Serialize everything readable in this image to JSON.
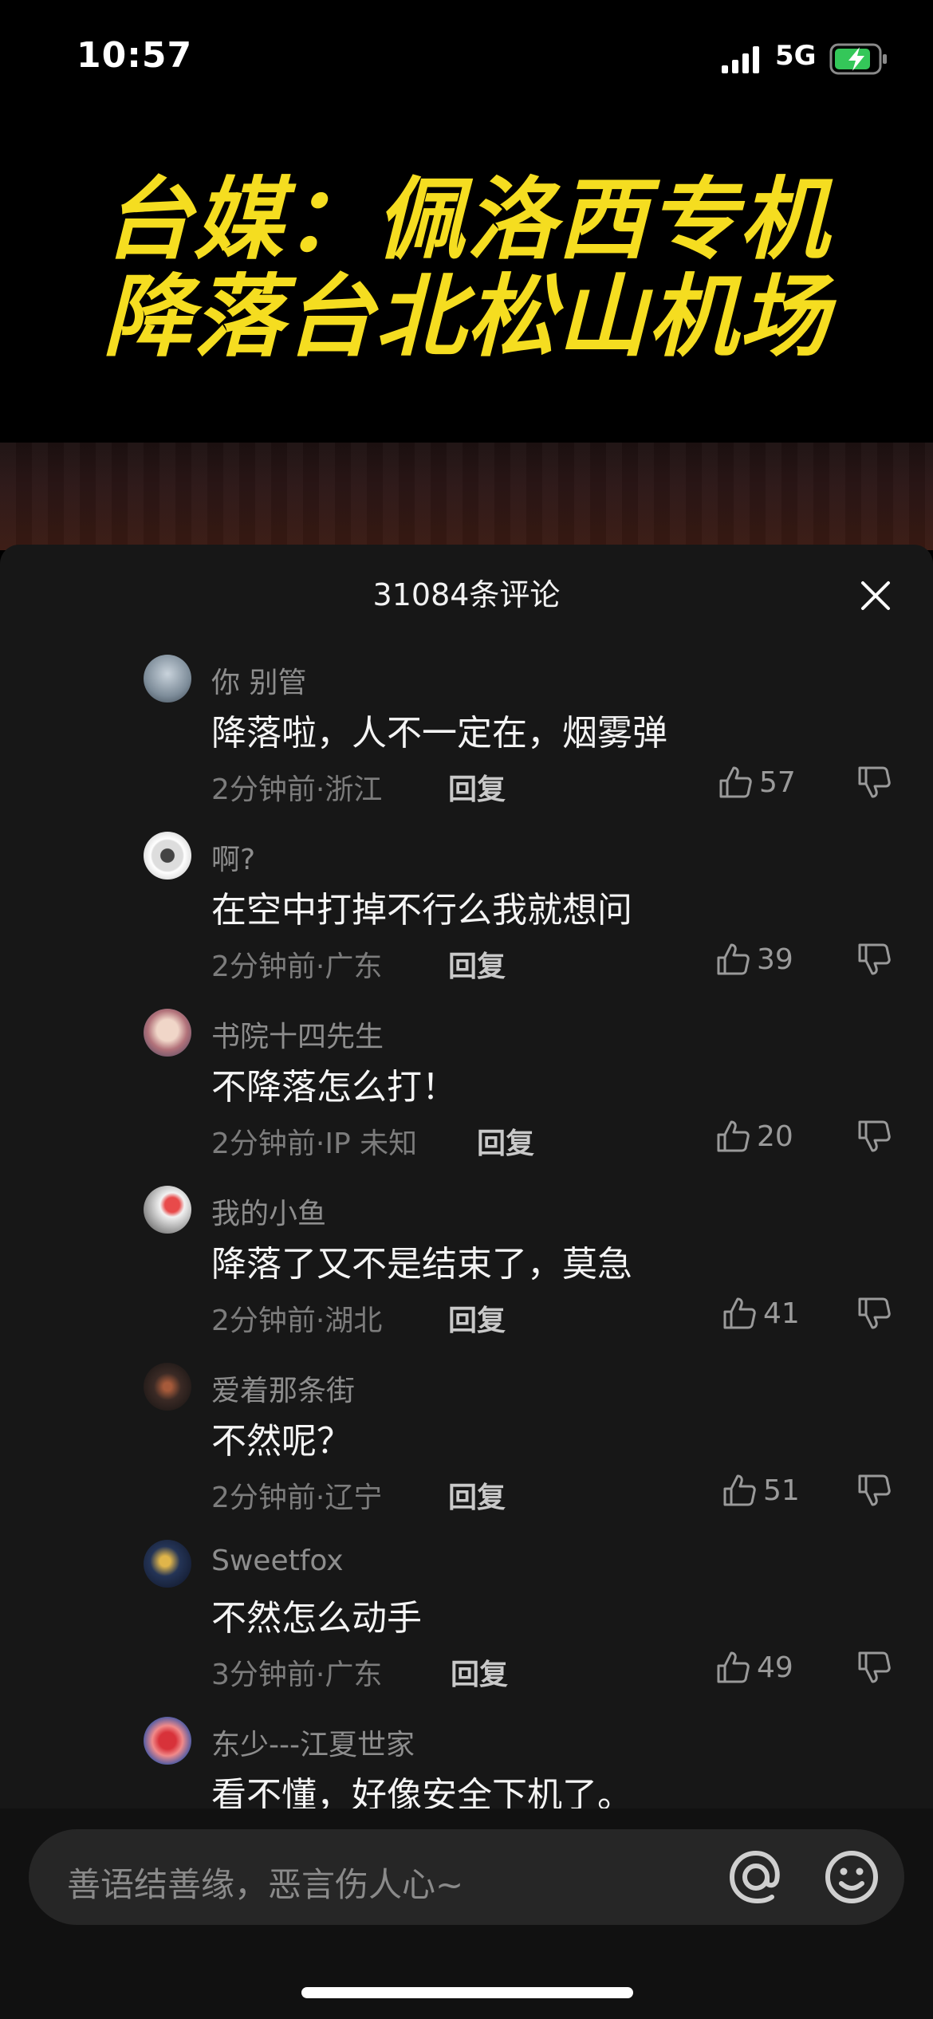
{
  "status_bar": {
    "time": "10:57",
    "network": "5G"
  },
  "video": {
    "title_line1": "台媒：佩洛西专机",
    "title_line2": "降落台北松山机场"
  },
  "comments_panel": {
    "title": "31084条评论"
  },
  "comments": [
    {
      "user": "你  别管",
      "text": "降落啦，人不一定在，烟雾弹",
      "meta": "2分钟前·浙江",
      "reply": "回复",
      "likes": "57"
    },
    {
      "user": "啊?",
      "text": "在空中打掉不行么我就想问",
      "meta": "2分钟前·广东",
      "reply": "回复",
      "likes": "39"
    },
    {
      "user": "书院十四先生",
      "text": "不降落怎么打！",
      "meta": "2分钟前·IP 未知",
      "reply": "回复",
      "likes": "20"
    },
    {
      "user": "我的小鱼",
      "text": "降落了又不是结束了，莫急",
      "meta": "2分钟前·湖北",
      "reply": "回复",
      "likes": "41"
    },
    {
      "user": "爱着那条街",
      "text": "不然呢？",
      "meta": "2分钟前·辽宁",
      "reply": "回复",
      "likes": "51"
    },
    {
      "user": "Sweetfox",
      "text": "不然怎么动手",
      "meta": "3分钟前·广东",
      "reply": "回复",
      "likes": "49"
    },
    {
      "user": "东少---江夏世家",
      "text": "看不懂，好像安全下机了。",
      "meta": "",
      "reply": "",
      "likes": ""
    }
  ],
  "input": {
    "placeholder": "善语结善缘，恶言伤人心~"
  },
  "icons": {
    "close": "close-icon",
    "like": "thumbs-up-icon",
    "dislike": "thumbs-down-icon",
    "at": "at-icon",
    "emoji": "emoji-icon",
    "signal": "cellular-signal-icon",
    "battery": "battery-charging-icon"
  },
  "colors": {
    "title_yellow": "#f5dd20",
    "panel_bg": "#171717",
    "battery_green": "#34c759"
  }
}
